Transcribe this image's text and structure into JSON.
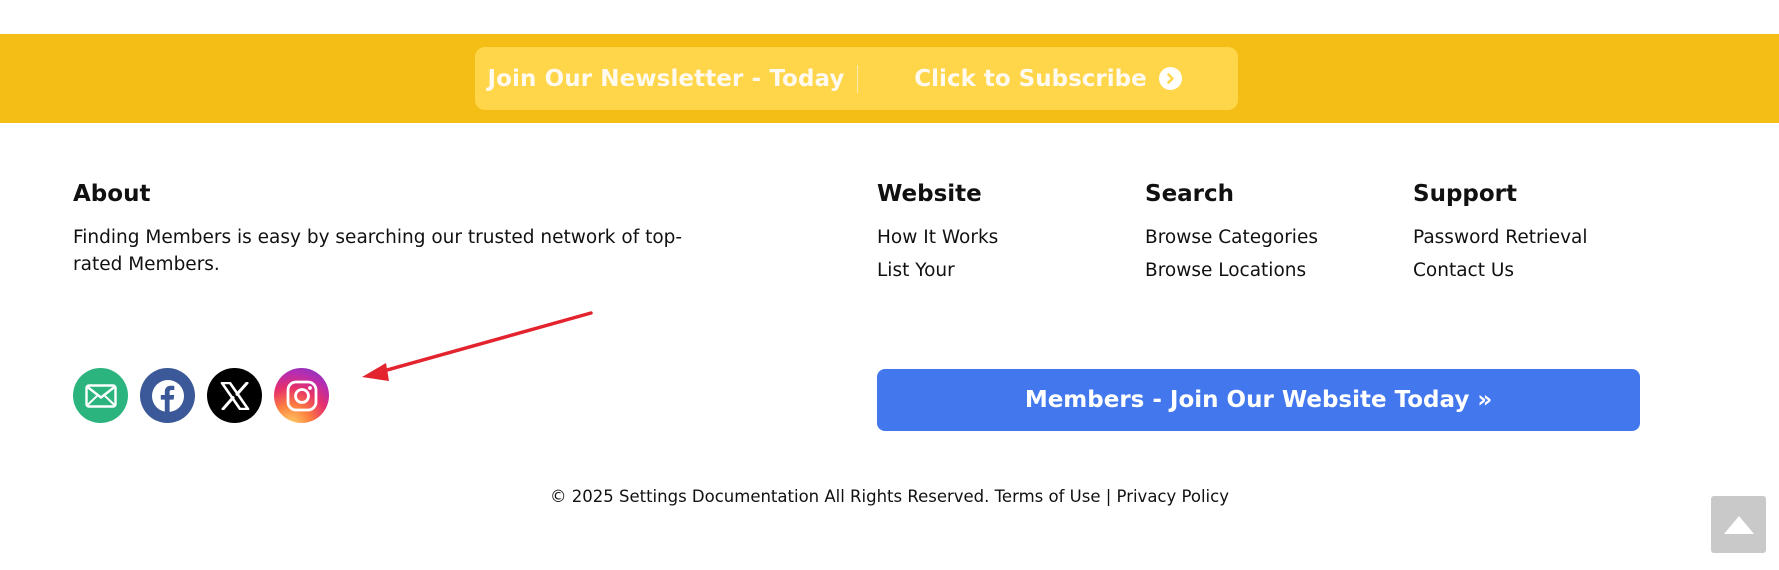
{
  "newsletter": {
    "title": "Join Our Newsletter - Today",
    "subscribe_label": "Click to Subscribe",
    "subscribe_icon": "chevron-circle-right-icon"
  },
  "footer": {
    "about": {
      "title": "About",
      "text": "Finding Members is easy by searching our trusted network of top-rated Members."
    },
    "website": {
      "title": "Website",
      "links": [
        "How It Works",
        "List Your"
      ]
    },
    "search": {
      "title": "Search",
      "links": [
        "Browse Categories",
        "Browse Locations"
      ]
    },
    "support": {
      "title": "Support",
      "links": [
        "Password Retrieval",
        "Contact Us"
      ]
    },
    "social": [
      {
        "name": "email",
        "icon": "email-icon",
        "color": "#2bb47d"
      },
      {
        "name": "facebook",
        "icon": "facebook-icon",
        "color": "#3b5998"
      },
      {
        "name": "x",
        "icon": "x-icon",
        "color": "#000000"
      },
      {
        "name": "instagram",
        "icon": "instagram-icon",
        "color": "gradient"
      }
    ],
    "join_button_label": "Members - Join Our Website Today »"
  },
  "copyright": {
    "text": "© 2025 Settings Documentation All Rights Reserved.",
    "terms_label": "Terms of Use",
    "separator": "|",
    "privacy_label": "Privacy Policy"
  },
  "scroll_top": {
    "icon": "triangle-up-icon"
  },
  "colors": {
    "band": "#f5be16",
    "pill": "#ffd54a",
    "join_button": "#4277ee",
    "annotation_arrow": "#e3232d"
  }
}
